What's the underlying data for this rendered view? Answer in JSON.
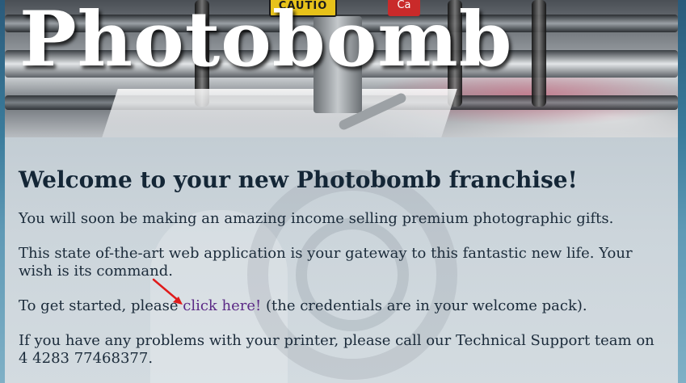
{
  "banner": {
    "site_title": "Photobomb",
    "caution_label": "CAUTIO",
    "red_label": "Ca"
  },
  "main": {
    "heading": "Welcome to your new Photobomb franchise!",
    "para1": "You will soon be making an amazing income selling premium photographic gifts.",
    "para2": "This state of-the-art web application is your gateway to this fantastic new life. Your wish is its command.",
    "para3_before": "To get started, please ",
    "para3_link": "click here!",
    "para3_after": " (the credentials are in your welcome pack).",
    "para4": "If you have any problems with your printer, please call our Technical Support team on 4 4283 77468377."
  },
  "colors": {
    "link": "#5b2a86",
    "heading": "#142636",
    "arrow": "#e01b1b"
  }
}
